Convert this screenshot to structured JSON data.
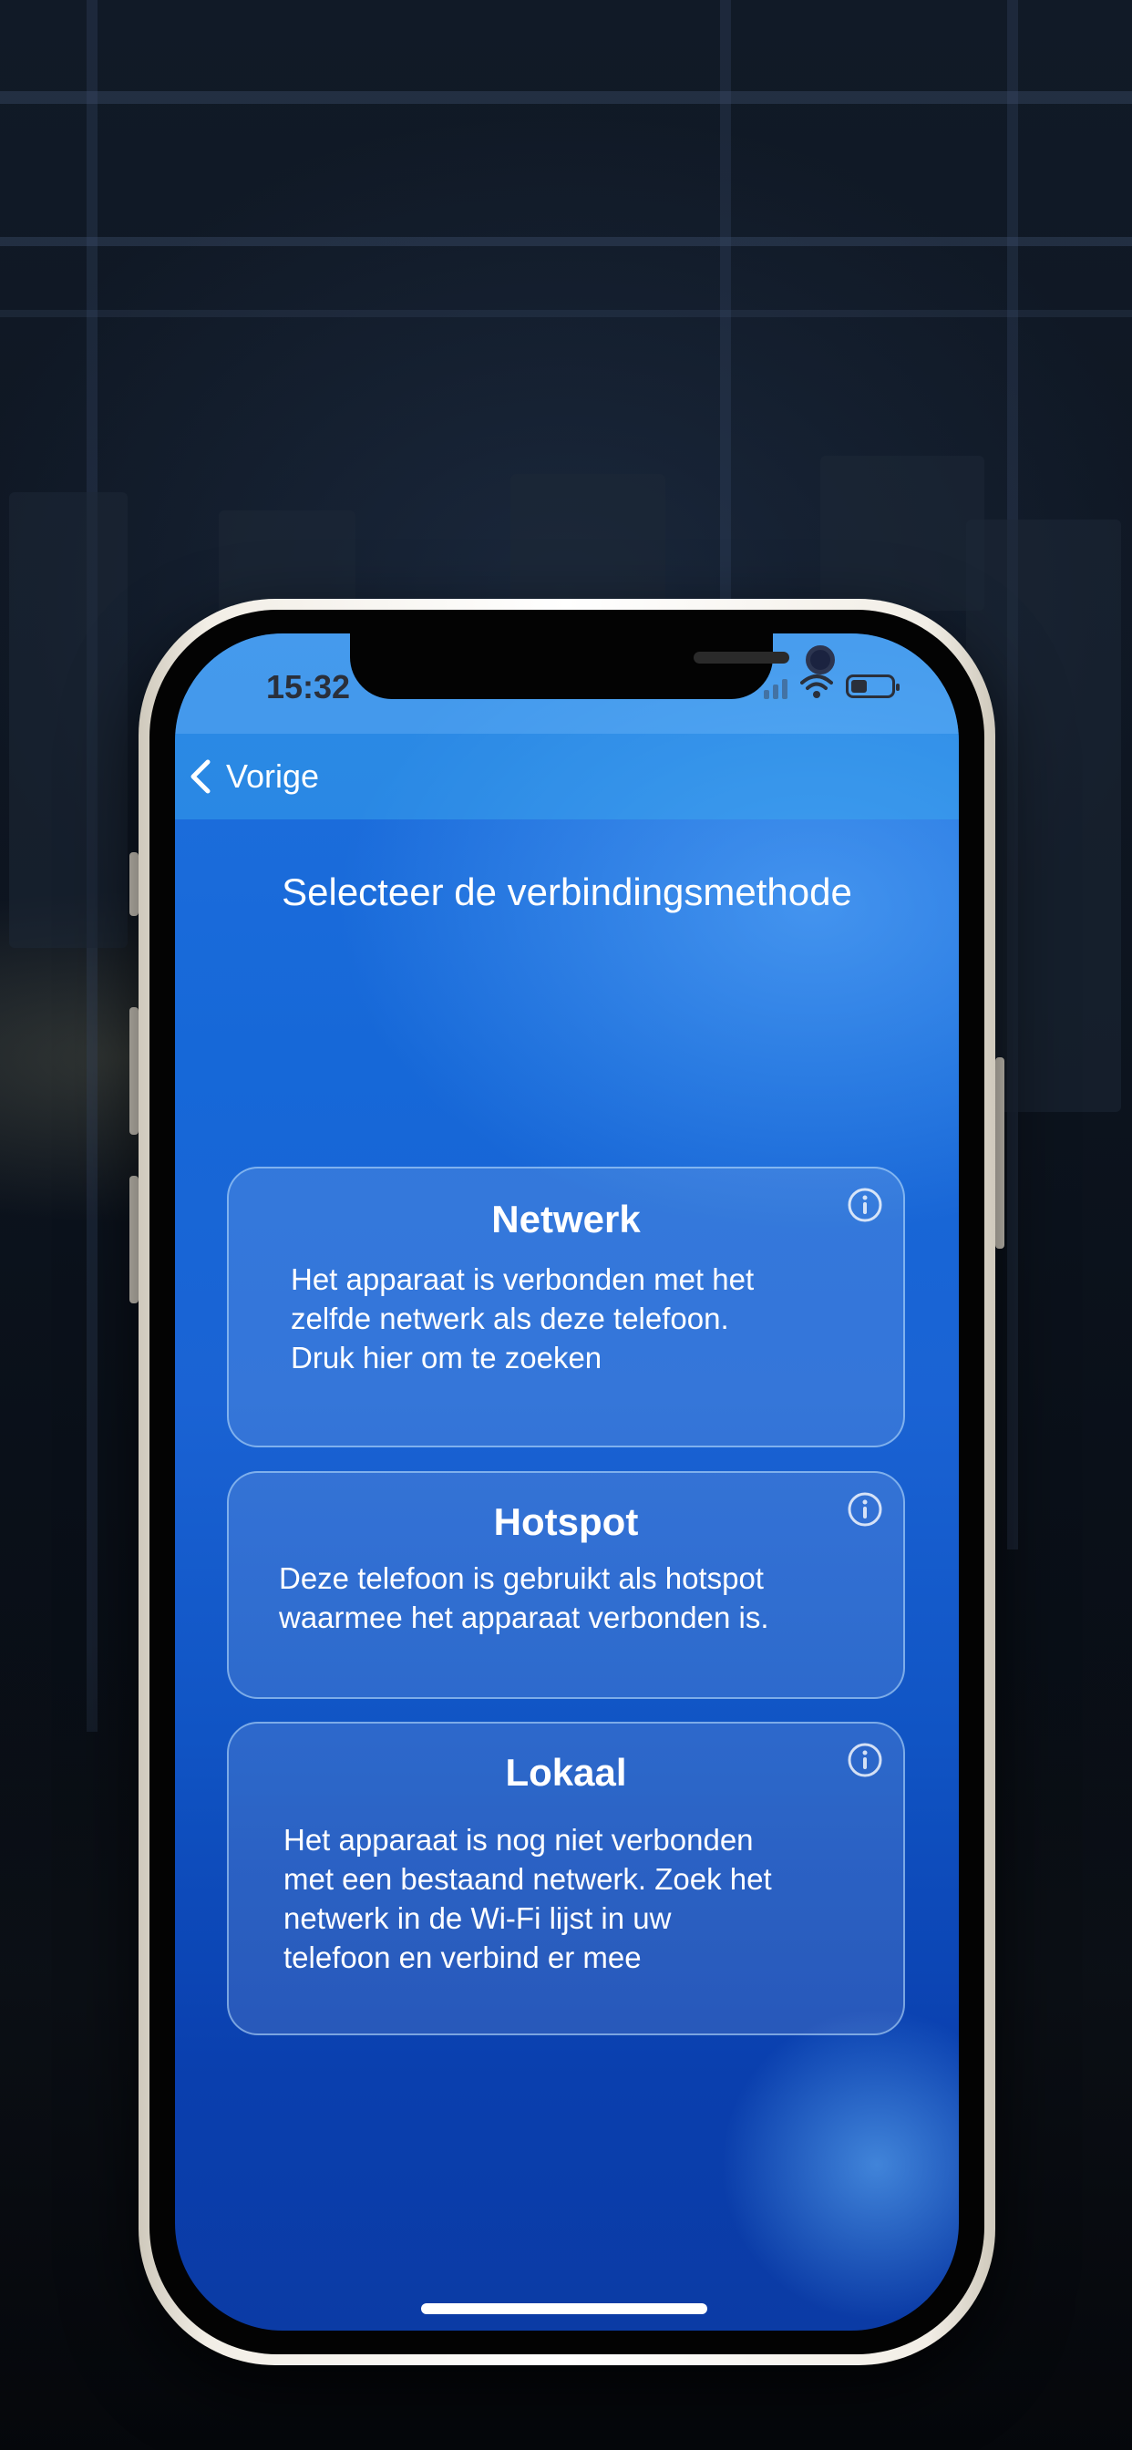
{
  "status_bar": {
    "time": "15:32"
  },
  "nav": {
    "back_label": "Vorige"
  },
  "page": {
    "title": "Selecteer de verbindingsmethode"
  },
  "options": [
    {
      "title": "Netwerk",
      "description": "Het apparaat is verbonden met het\nzelfde netwerk als deze telefoon.\nDruk hier om te zoeken",
      "icon": "info-icon"
    },
    {
      "title": "Hotspot",
      "description": "Deze telefoon is gebruikt als hotspot\nwaarmee het apparaat verbonden is.",
      "icon": "info-icon"
    },
    {
      "title": "Lokaal",
      "description": "Het apparaat is nog niet verbonden\nmet een bestaand netwerk. Zoek het\nnetwerk in de Wi-Fi lijst in uw\ntelefoon en verbind er mee",
      "icon": "info-icon"
    }
  ],
  "icons": {
    "back": "chevron-left-icon",
    "wifi": "wifi-icon",
    "battery": "battery-icon",
    "signal": "signal-icon"
  },
  "colors": {
    "screen_top": "#1f6fdd",
    "screen_bottom": "#0b3ba5",
    "text": "#ffffff",
    "card_border": "#bee1ff"
  }
}
